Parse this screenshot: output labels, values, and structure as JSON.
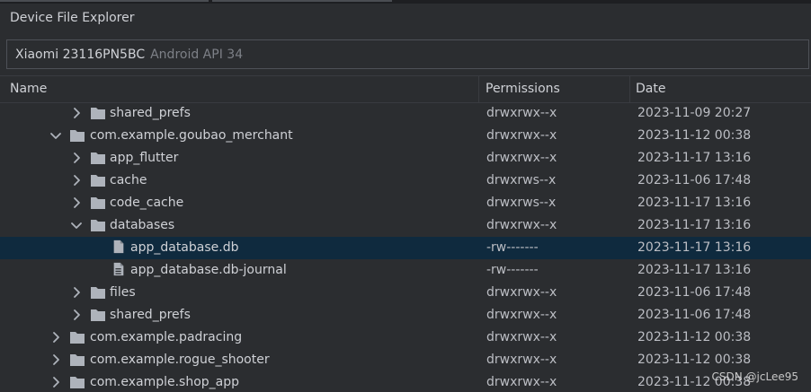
{
  "window": {
    "title": "Device File Explorer"
  },
  "device": {
    "name": "Xiaomi 23116PN5BC",
    "api": "Android API 34"
  },
  "columns": {
    "name": "Name",
    "permissions": "Permissions",
    "date": "Date"
  },
  "colors": {
    "background": "#2b2d30",
    "selection": "#0f2a3e",
    "folder": "#aeb3bb"
  },
  "rows": [
    {
      "name": "shared_prefs",
      "type": "folder",
      "expanded": false,
      "depth": 2,
      "permissions": "drwxrwx--x",
      "date": "2023-11-09 20:27"
    },
    {
      "name": "com.example.goubao_merchant",
      "type": "folder",
      "expanded": true,
      "depth": 1,
      "permissions": "drwxrwx--x",
      "date": "2023-11-12 00:38"
    },
    {
      "name": "app_flutter",
      "type": "folder",
      "expanded": false,
      "depth": 2,
      "permissions": "drwxrwx--x",
      "date": "2023-11-17 13:16"
    },
    {
      "name": "cache",
      "type": "folder",
      "expanded": false,
      "depth": 2,
      "permissions": "drwxrws--x",
      "date": "2023-11-06 17:48"
    },
    {
      "name": "code_cache",
      "type": "folder",
      "expanded": false,
      "depth": 2,
      "permissions": "drwxrws--x",
      "date": "2023-11-17 13:16"
    },
    {
      "name": "databases",
      "type": "folder",
      "expanded": true,
      "depth": 2,
      "permissions": "drwxrwx--x",
      "date": "2023-11-17 13:16"
    },
    {
      "name": "app_database.db",
      "type": "file",
      "depth": 3,
      "selected": true,
      "permissions": "-rw-------",
      "date": "2023-11-17 13:16"
    },
    {
      "name": "app_database.db-journal",
      "type": "text-file",
      "depth": 3,
      "permissions": "-rw-------",
      "date": "2023-11-17 13:16"
    },
    {
      "name": "files",
      "type": "folder",
      "expanded": false,
      "depth": 2,
      "permissions": "drwxrwx--x",
      "date": "2023-11-06 17:48"
    },
    {
      "name": "shared_prefs",
      "type": "folder",
      "expanded": false,
      "depth": 2,
      "permissions": "drwxrwx--x",
      "date": "2023-11-06 17:48"
    },
    {
      "name": "com.example.padracing",
      "type": "folder",
      "expanded": false,
      "depth": 1,
      "permissions": "drwxrwx--x",
      "date": "2023-11-12 00:38"
    },
    {
      "name": "com.example.rogue_shooter",
      "type": "folder",
      "expanded": false,
      "depth": 1,
      "permissions": "drwxrwx--x",
      "date": "2023-11-12 00:38"
    },
    {
      "name": "com.example.shop_app",
      "type": "folder",
      "expanded": false,
      "depth": 1,
      "permissions": "drwxrwx--x",
      "date": "2023-11-12 00:38"
    }
  ],
  "watermark": "CSDN @jcLee95"
}
